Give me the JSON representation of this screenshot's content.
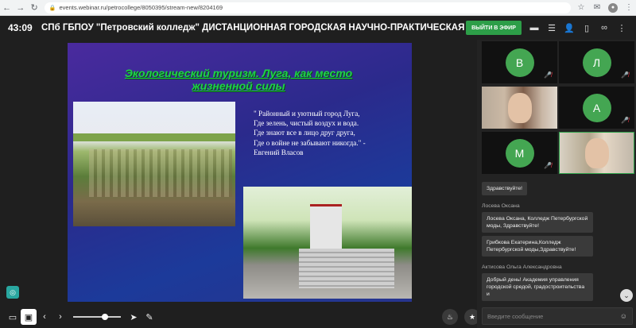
{
  "browser": {
    "url": "events.webinar.ru/petrocollege/8050395/stream-new/8204169",
    "profile_initial": ""
  },
  "header": {
    "timer": "43:09",
    "title": "СПб ГБПОУ \"Петровский колледж\"   ДИСТАНЦИОННАЯ ГОРОДСКАЯ НАУЧНО-ПРАКТИЧЕСКАЯ КОНФЕРЕ...",
    "live_button": "ВЫЙТИ В ЭФИР"
  },
  "slide": {
    "title": "Экологический туризм. Луга, как место жизненной силы",
    "quote_lines": [
      "\" Районный и уютный город Луга,",
      "Где зелень, чистый воздух и вода.",
      "Где знают все в лицо друг друга,",
      "Где о войне не забывают никогда.\" -",
      "Евгений Власов"
    ]
  },
  "participants": [
    {
      "initial": "В",
      "type": "avatar",
      "muted": true
    },
    {
      "initial": "Л",
      "type": "avatar",
      "muted": true
    },
    {
      "initial": "",
      "type": "video",
      "muted": false
    },
    {
      "initial": "А",
      "type": "avatar",
      "muted": true
    },
    {
      "initial": "М",
      "type": "avatar",
      "muted": true
    },
    {
      "initial": "",
      "type": "video",
      "muted": false
    }
  ],
  "chat": {
    "first_message": "Здравствуйте!",
    "author_1": "Лосева Оксана",
    "msg_1": "Лосева Оксана, Колледж Петербургской моды, Здравствуйте!",
    "msg_2": "Грибкова Екатерина,Колледж Петербургской моды,Здравствуйте!",
    "author_2": "Актисова Ольга Александровна",
    "msg_3": "Добрый день! Академия управления городской средой, градостроительства и",
    "input_placeholder": "Введите сообщение"
  },
  "colors": {
    "accent_green": "#2d9e48",
    "avatar_green": "#44a652",
    "mic_off_red": "#e34444"
  },
  "icons": [
    "back-icon",
    "forward-icon",
    "reload-icon",
    "lock-icon",
    "star-icon",
    "extension-icon",
    "menu-icon",
    "chat-icon",
    "poll-icon",
    "user-icon",
    "file-icon",
    "link-icon",
    "more-icon",
    "screen-icon",
    "slide-icon",
    "prev-icon",
    "next-icon",
    "pointer-icon",
    "brush-icon",
    "fire-icon",
    "star-reaction-icon",
    "emoji-icon",
    "chevron-down-icon"
  ]
}
